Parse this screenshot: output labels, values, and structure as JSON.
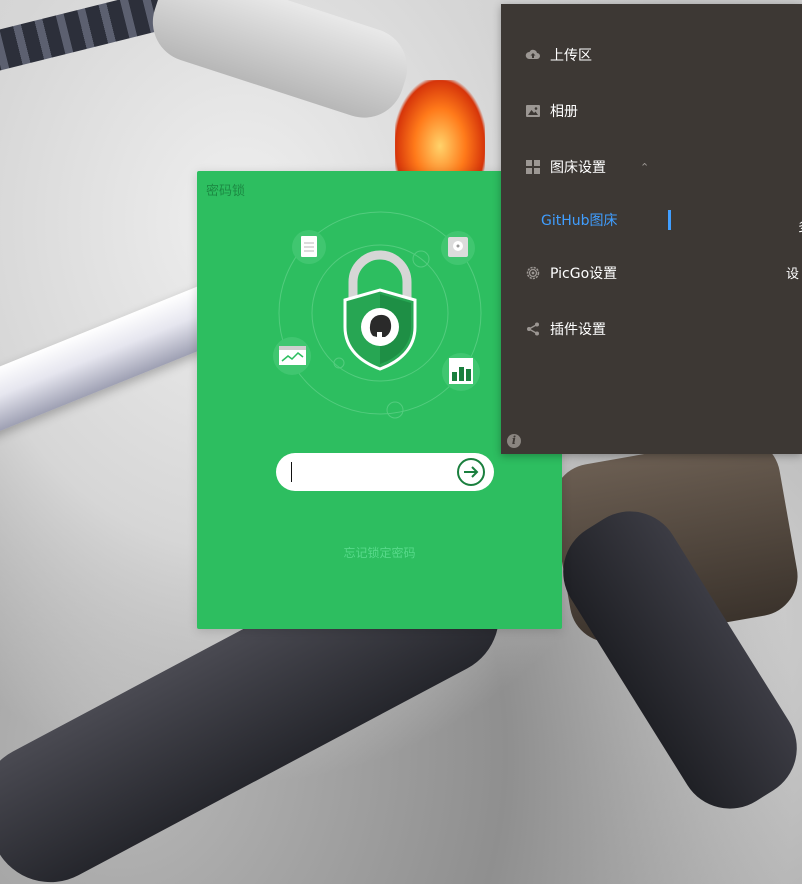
{
  "lock_window": {
    "title": "密码锁",
    "password": {
      "value": "",
      "placeholder": ""
    },
    "submit_icon": "arrow-right-circle-icon",
    "forgot_link": "忘记锁定密码",
    "accent_color": "#2dbe60"
  },
  "menu": {
    "items": [
      {
        "label": "上传区",
        "icon": "cloud-upload-icon"
      },
      {
        "label": "相册",
        "icon": "image-icon"
      },
      {
        "label": "图床设置",
        "icon": "grid-icon",
        "arrow": "⌃"
      },
      {
        "label": "GitHub图床",
        "submenu": true,
        "active": true
      },
      {
        "label": "PicGo设置",
        "icon": "gear-icon"
      },
      {
        "label": "插件设置",
        "icon": "share-icon"
      }
    ],
    "side_texts": [
      "多",
      "设"
    ],
    "info_icon": "info-icon",
    "active_color": "#409eff"
  }
}
